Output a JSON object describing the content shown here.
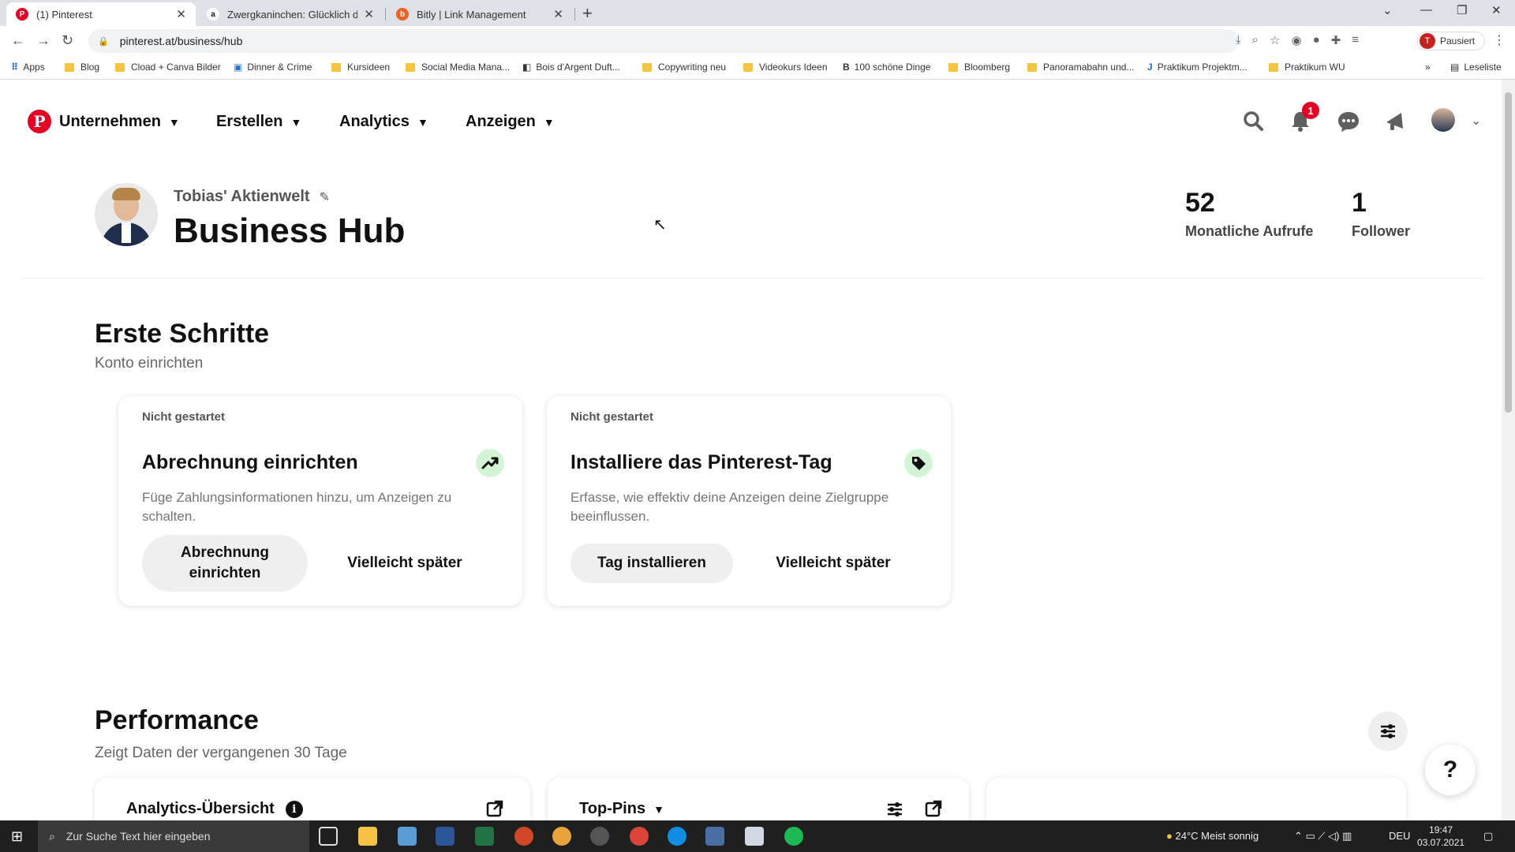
{
  "browser": {
    "tabs": [
      {
        "title": "(1) Pinterest",
        "active": true
      },
      {
        "title": "Zwergkaninchen: Glücklich durch",
        "active": false
      },
      {
        "title": "Bitly | Link Management",
        "active": false
      }
    ],
    "url": "pinterest.at/business/hub",
    "paused_label": "Pausiert",
    "profile_initial": "T",
    "reading_list": "Leseliste",
    "bookmarks": [
      "Apps",
      "Blog",
      "Cload + Canva Bilder",
      "Dinner & Crime",
      "Kursideen",
      "Social Media Mana...",
      "Bois d'Argent Duft...",
      "Copywriting neu",
      "Videokurs Ideen",
      "100 schöne Dinge",
      "Bloomberg",
      "Panoramabahn und...",
      "Praktikum Projektm...",
      "Praktikum WU"
    ]
  },
  "header": {
    "nav": [
      "Unternehmen",
      "Erstellen",
      "Analytics",
      "Anzeigen"
    ],
    "notification_count": "1"
  },
  "profile": {
    "name": "Tobias' Aktienwelt",
    "page_title": "Business Hub",
    "stats": [
      {
        "value": "52",
        "label": "Monatliche Aufrufe"
      },
      {
        "value": "1",
        "label": "Follower"
      }
    ]
  },
  "getting_started": {
    "title": "Erste Schritte",
    "subtitle": "Konto einrichten",
    "cards": [
      {
        "status": "Nicht gestartet",
        "title": "Abrechnung einrichten",
        "description": "Füge Zahlungsinformationen hinzu, um Anzeigen zu schalten.",
        "primary_label": "Abrechnung einrichten",
        "later_label": "Vielleicht später",
        "icon": "trend-up-icon"
      },
      {
        "status": "Nicht gestartet",
        "title": "Installiere das Pinterest-Tag",
        "description": "Erfasse, wie effektiv deine Anzeigen deine Zielgruppe beeinflussen.",
        "primary_label": "Tag installieren",
        "later_label": "Vielleicht später",
        "icon": "tag-icon"
      }
    ]
  },
  "performance": {
    "title": "Performance",
    "subtitle": "Zeigt Daten der vergangenen 30 Tage",
    "cards": [
      "Analytics-Übersicht",
      "Top-Pins"
    ]
  },
  "help_label": "?",
  "taskbar": {
    "search_placeholder": "Zur Suche Text hier eingeben",
    "weather": "24°C  Meist sonnig",
    "language": "DEU",
    "time": "19:47",
    "date": "03.07.2021"
  },
  "colors": {
    "pinterest_red": "#e60023",
    "icon_green_bg": "#d3f5d6",
    "button_gray": "#efefef"
  }
}
